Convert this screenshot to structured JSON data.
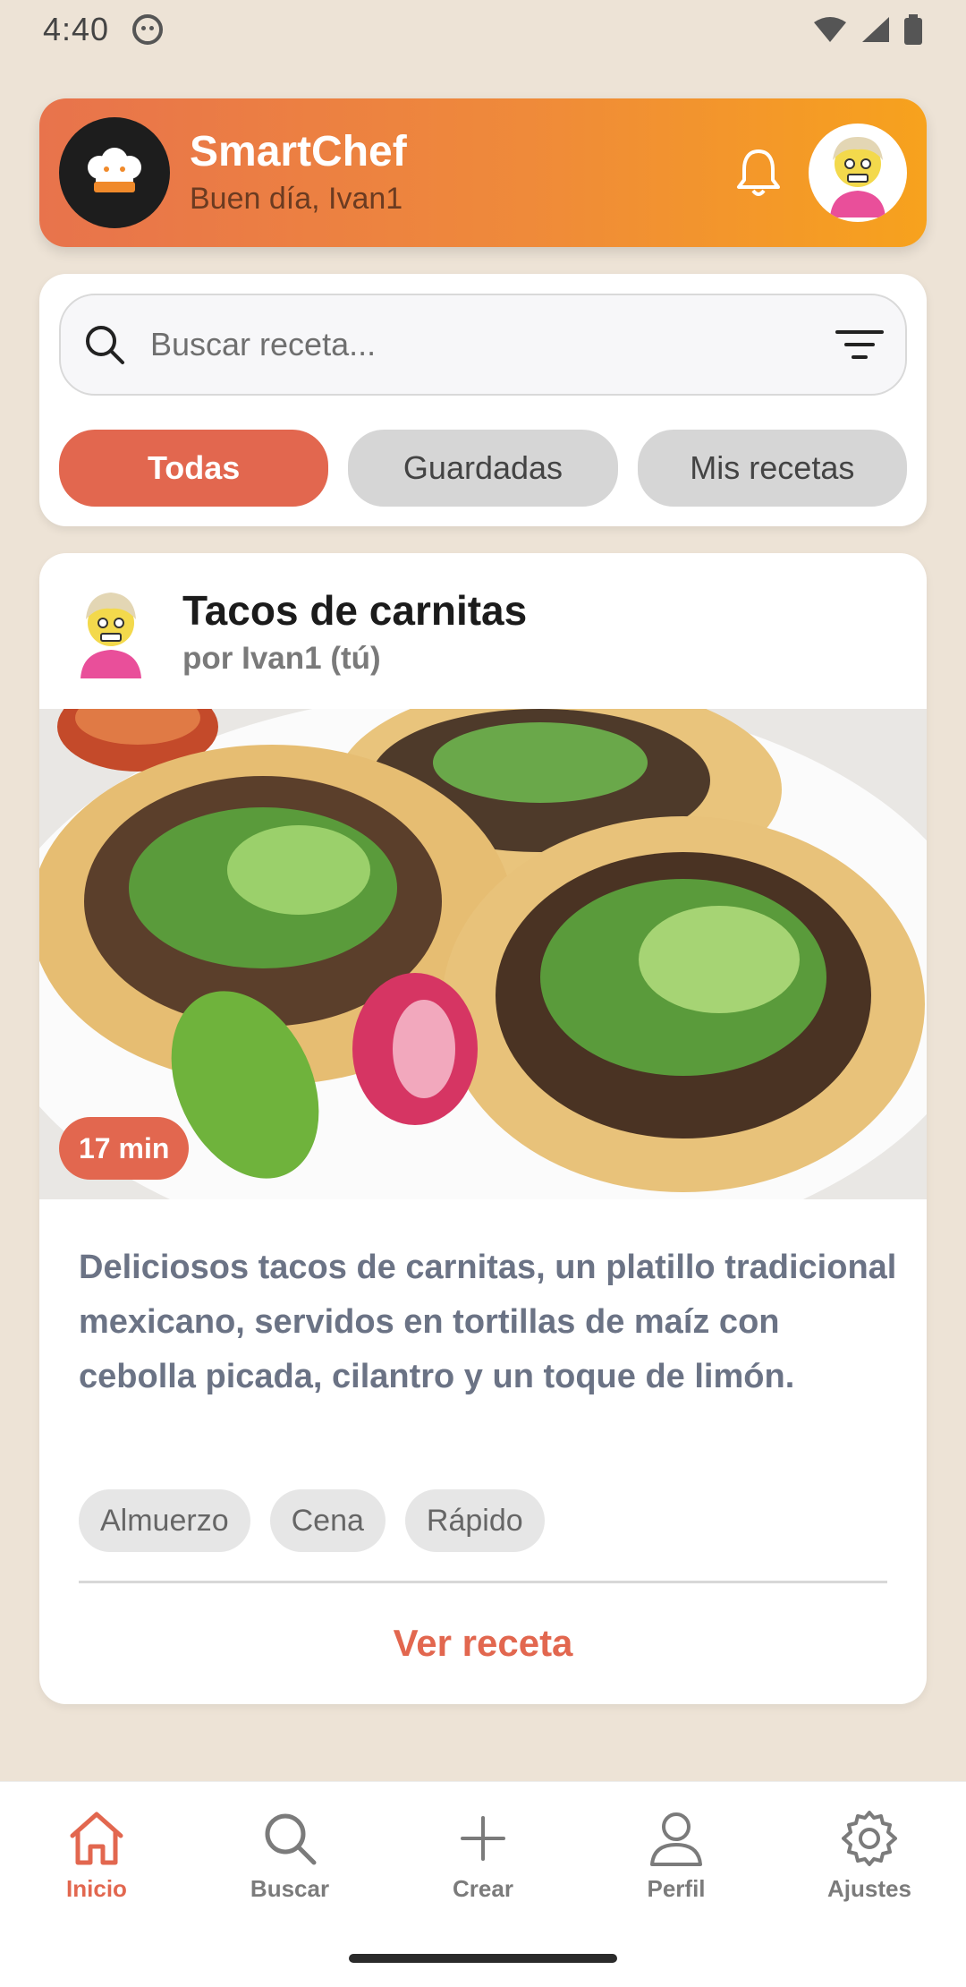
{
  "status_bar": {
    "time": "4:40"
  },
  "header": {
    "app_title": "SmartChef",
    "greeting": "Buen día, Ivan1"
  },
  "search": {
    "placeholder": "Buscar receta...",
    "value": ""
  },
  "tabs": [
    {
      "label": "Todas",
      "active": true
    },
    {
      "label": "Guardadas",
      "active": false
    },
    {
      "label": "Mis recetas",
      "active": false
    }
  ],
  "recipe": {
    "title": "Tacos de carnitas",
    "author": "por Ivan1 (tú)",
    "time": "17 min",
    "description": "Deliciosos tacos de carnitas, un platillo tradicional mexicano, servidos en tortillas de maíz con cebolla picada, cilantro y un toque de limón.",
    "tags": [
      "Almuerzo",
      "Cena",
      "Rápido"
    ],
    "cta": "Ver receta"
  },
  "bottom_nav": [
    {
      "label": "Inicio",
      "icon": "home-icon",
      "active": true
    },
    {
      "label": "Buscar",
      "icon": "search-icon",
      "active": false
    },
    {
      "label": "Crear",
      "icon": "plus-icon",
      "active": false
    },
    {
      "label": "Perfil",
      "icon": "person-icon",
      "active": false
    },
    {
      "label": "Ajustes",
      "icon": "gear-icon",
      "active": false
    }
  ],
  "colors": {
    "accent": "#e2674f",
    "background": "#ede3d6",
    "header_gradient_start": "#e8734c",
    "header_gradient_end": "#f7a21d"
  }
}
